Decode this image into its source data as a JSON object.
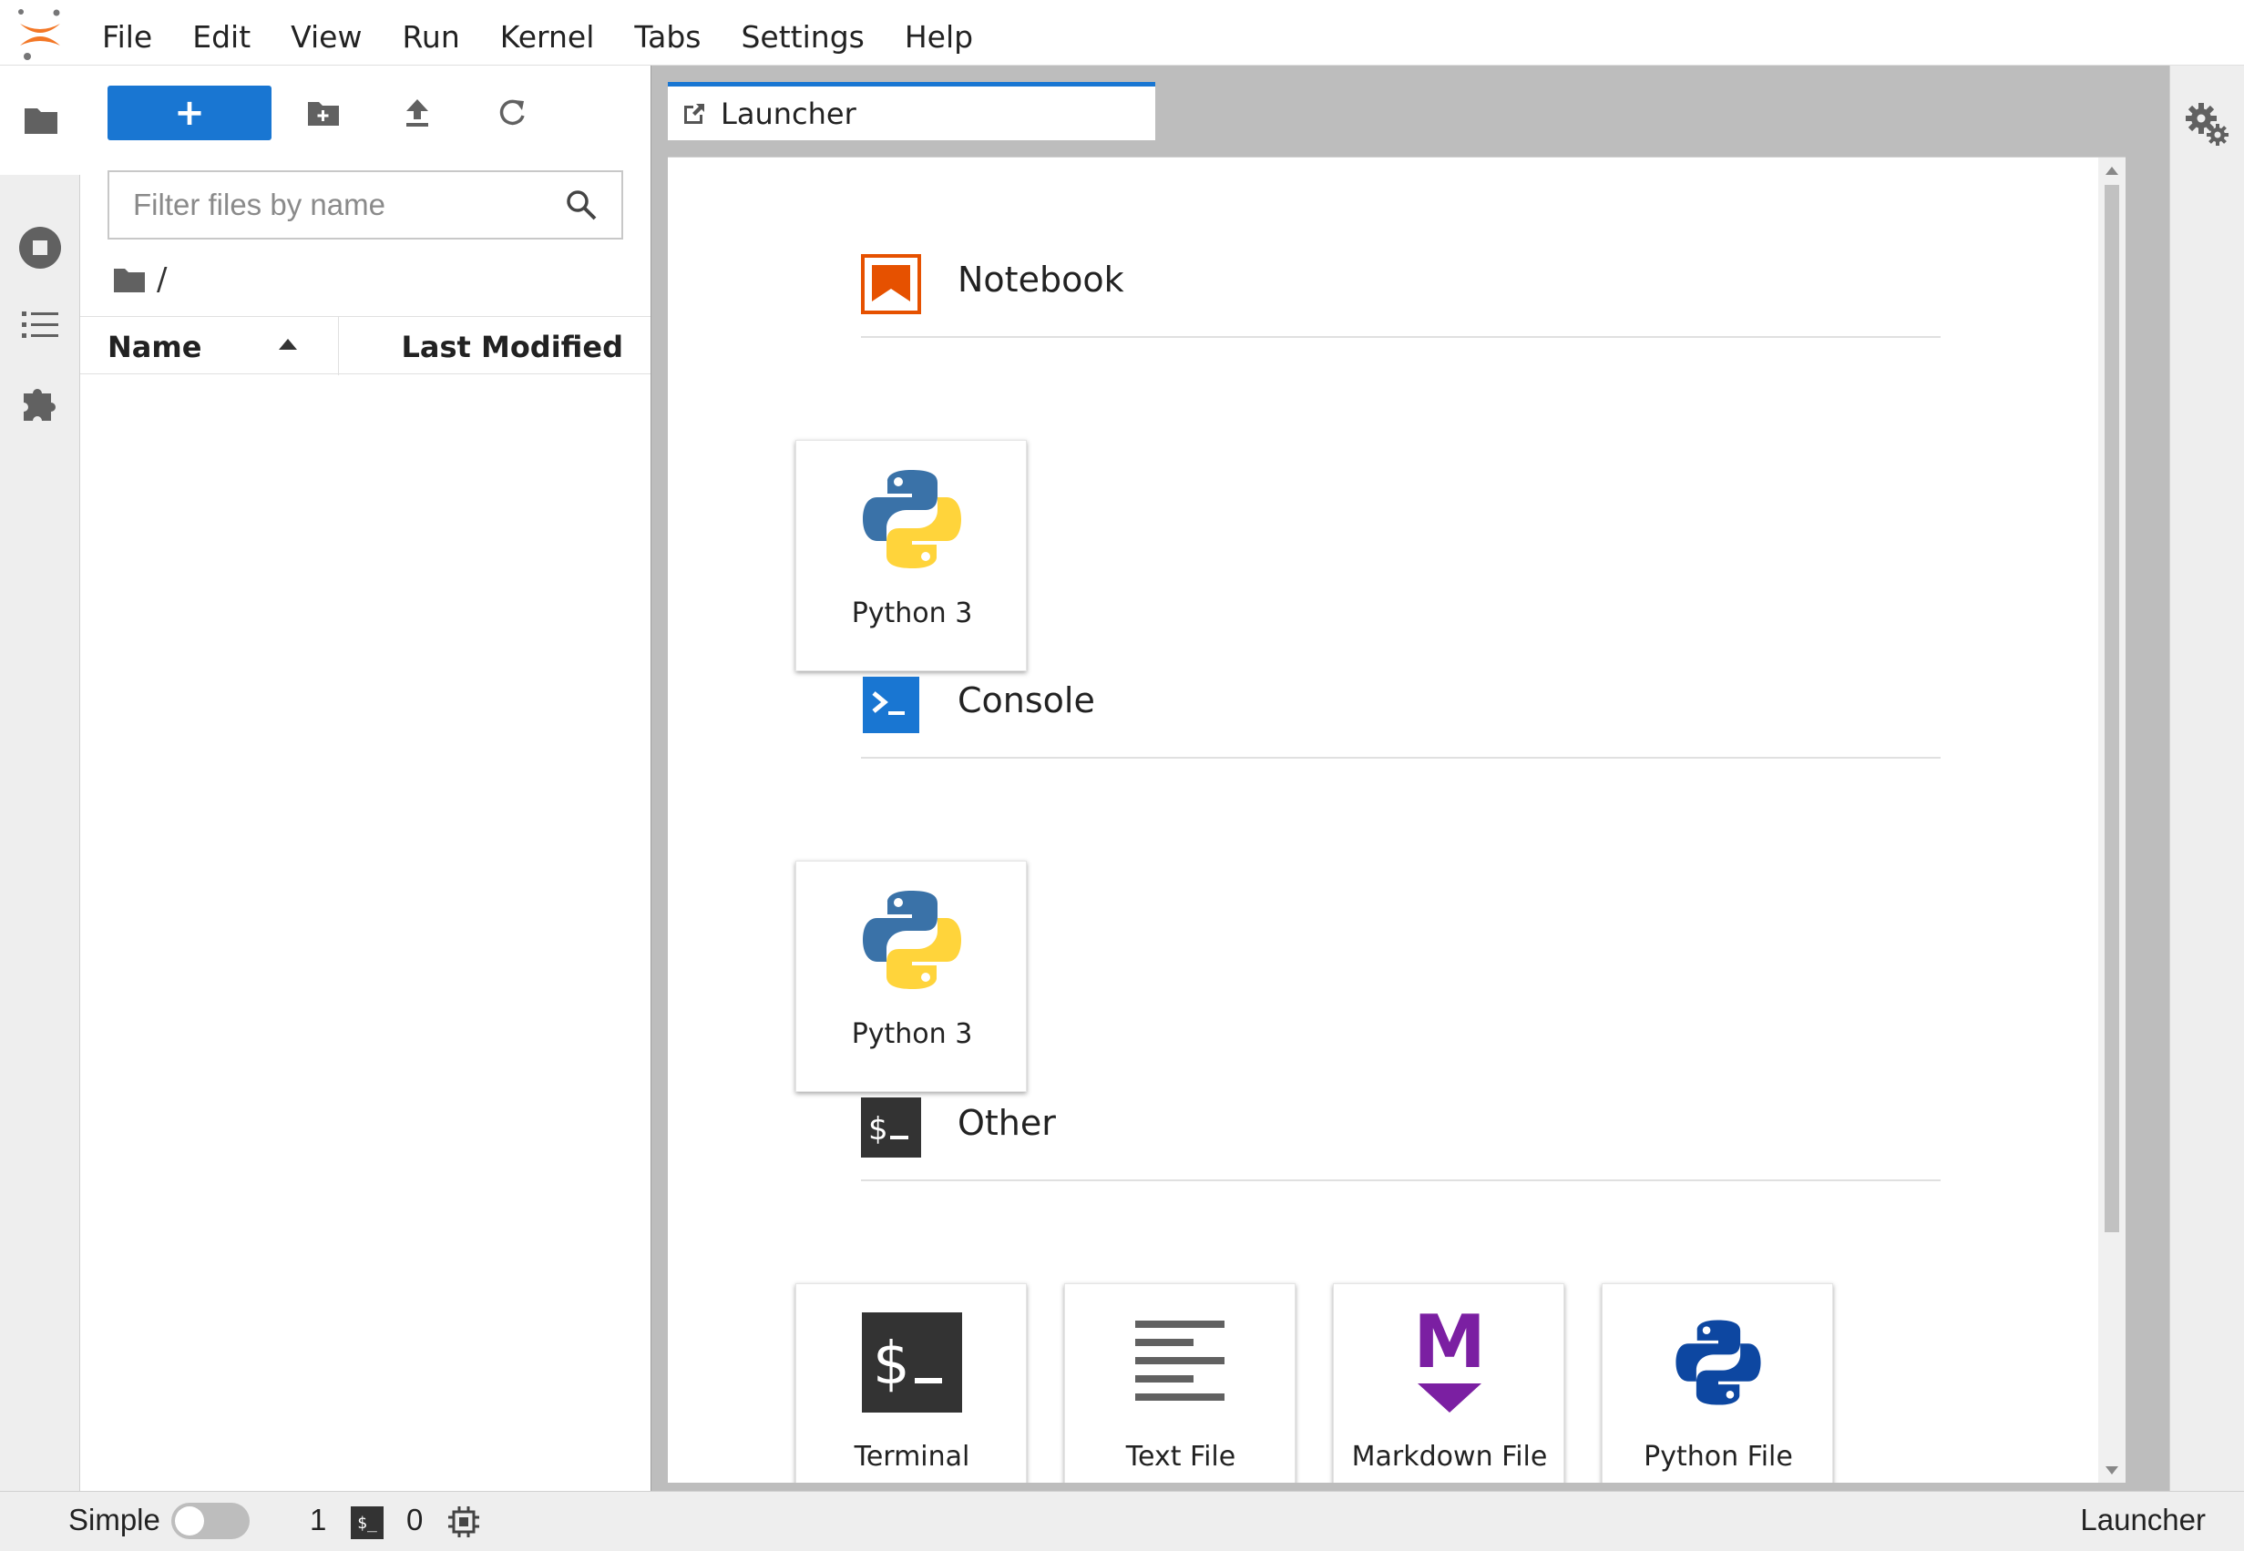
{
  "menubar": {
    "items": [
      "File",
      "Edit",
      "View",
      "Run",
      "Kernel",
      "Tabs",
      "Settings",
      "Help"
    ]
  },
  "left_bar": {
    "icons": [
      "folder-icon",
      "running-icon",
      "toc-icon",
      "extension-icon"
    ]
  },
  "filebrowser": {
    "new_launcher": "+",
    "filter_placeholder": "Filter files by name",
    "breadcrumb": "/",
    "columns": {
      "name": "Name",
      "modified": "Last Modified"
    }
  },
  "tabs": [
    {
      "label": "Launcher",
      "active": true
    }
  ],
  "launcher": {
    "sections": [
      {
        "title": "Notebook",
        "cards": [
          {
            "label": "Python 3",
            "icon": "python-logo-icon"
          }
        ]
      },
      {
        "title": "Console",
        "cards": [
          {
            "label": "Python 3",
            "icon": "python-logo-icon"
          }
        ]
      },
      {
        "title": "Other",
        "cards": [
          {
            "label": "Terminal",
            "icon": "terminal-icon"
          },
          {
            "label": "Text File",
            "icon": "text-file-icon"
          },
          {
            "label": "Markdown File",
            "icon": "markdown-icon"
          },
          {
            "label": "Python File",
            "icon": "python-file-icon"
          }
        ]
      }
    ]
  },
  "statusbar": {
    "simple_label": "Simple",
    "terminals_count": "1",
    "terminal_badge": "$_",
    "kernels_count": "0",
    "right_label": "Launcher"
  },
  "colors": {
    "accent": "#1976d2",
    "notebook": "#e65100",
    "console": "#1976d2",
    "other": "#333333",
    "markdown": "#7b1fa2",
    "python_blue": "#3a72a8",
    "python_yellow": "#ffd43b"
  }
}
